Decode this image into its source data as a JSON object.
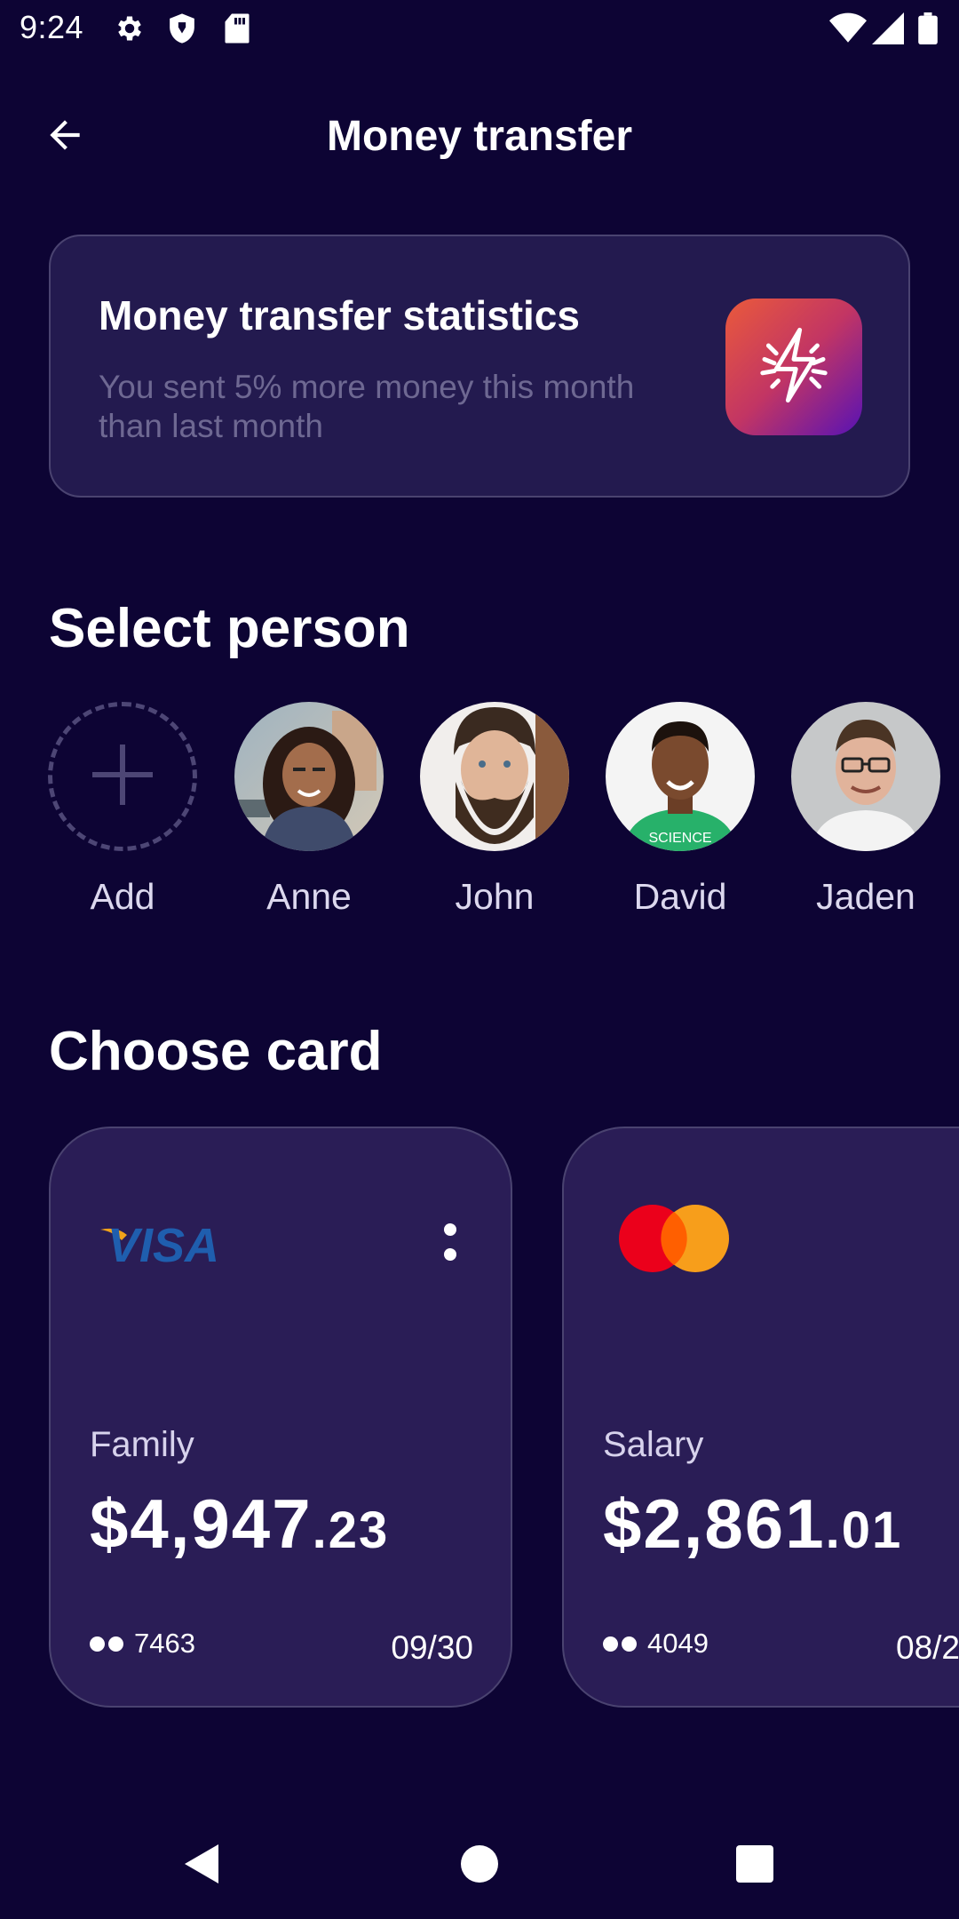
{
  "status_bar": {
    "time": "9:24",
    "icons": [
      "gear-icon",
      "shield-icon",
      "sd-card-icon",
      "wifi-icon",
      "signal-icon",
      "battery-icon"
    ]
  },
  "app_bar": {
    "title": "Money transfer",
    "back_icon": "arrow-left-icon"
  },
  "stats": {
    "title": "Money transfer statistics",
    "subtitle": "You sent 5% more money this month than last month",
    "icon": "lightning-icon",
    "gradient": [
      "#ea5a3b",
      "#c23564",
      "#5712b5"
    ]
  },
  "people_section": {
    "title": "Select person",
    "add_label": "Add",
    "people": [
      {
        "name": "Anne"
      },
      {
        "name": "John"
      },
      {
        "name": "David"
      },
      {
        "name": "Jaden"
      }
    ]
  },
  "cards_section": {
    "title": "Choose card",
    "cards": [
      {
        "brand": "VISA",
        "name": "Family",
        "balance_main": "$4,947",
        "balance_cents": ".23",
        "last_digits": "7463",
        "expiry": "09/30"
      },
      {
        "brand": "mastercard",
        "name": "Salary",
        "balance_main": "$2,861",
        "balance_cents": ".01",
        "last_digits": "4049",
        "expiry": "08/2"
      }
    ]
  },
  "colors": {
    "background": "#0d0434",
    "card_surface": "#2a1d56",
    "muted_text": "#6e6892"
  }
}
